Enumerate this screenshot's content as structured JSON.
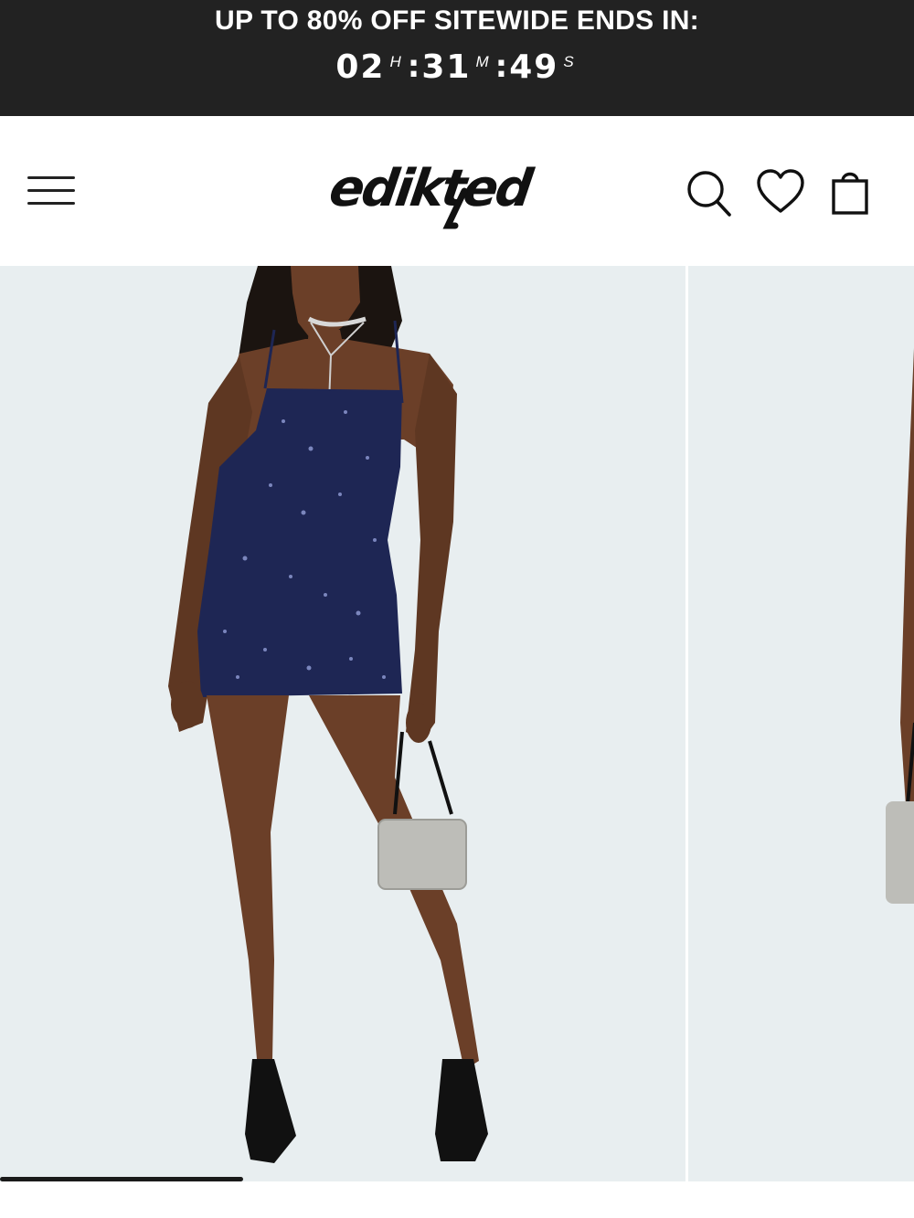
{
  "promo": {
    "text": "UP TO 80% OFF SITEWIDE ENDS IN:",
    "countdown": {
      "hours": "02",
      "hours_unit": "H",
      "minutes": "31",
      "minutes_unit": "M",
      "seconds": "49",
      "seconds_unit": "S",
      "separator": ":"
    }
  },
  "header": {
    "logo_text": "edikted",
    "icons": [
      "menu-icon",
      "search-icon",
      "heart-icon",
      "bag-icon"
    ]
  },
  "gallery": {
    "slides": [
      "product-image-front",
      "product-image-side"
    ],
    "scroll_progress": 0.266
  },
  "colors": {
    "banner_bg": "#222222",
    "image_bg": "#e8eef0",
    "dress": "#1e2654"
  }
}
